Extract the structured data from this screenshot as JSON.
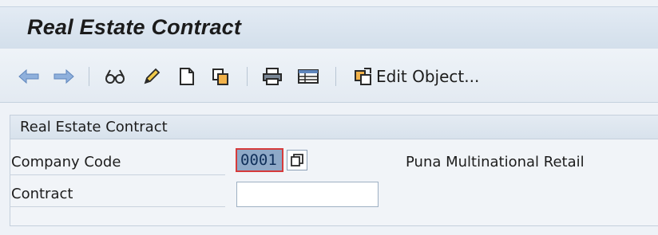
{
  "window": {
    "title": "Real Estate Contract"
  },
  "toolbar": {
    "icons": [
      "back-arrow-icon",
      "forward-arrow-icon",
      "display-glasses-icon",
      "edit-pencil-icon",
      "create-document-icon",
      "copy-icon",
      "print-icon",
      "table-view-icon",
      "edit-object-icon"
    ],
    "edit_object_label": "Edit Object..."
  },
  "form": {
    "group_title": "Real Estate Contract",
    "company_code": {
      "label": "Company Code",
      "value": "0001",
      "description": "Puna Multinational Retail"
    },
    "contract": {
      "label": "Contract",
      "value": ""
    }
  },
  "colors": {
    "title_bar": "#d8e3ee",
    "highlight_field": "#8ea9c7",
    "focus_border": "#d63b3b"
  }
}
